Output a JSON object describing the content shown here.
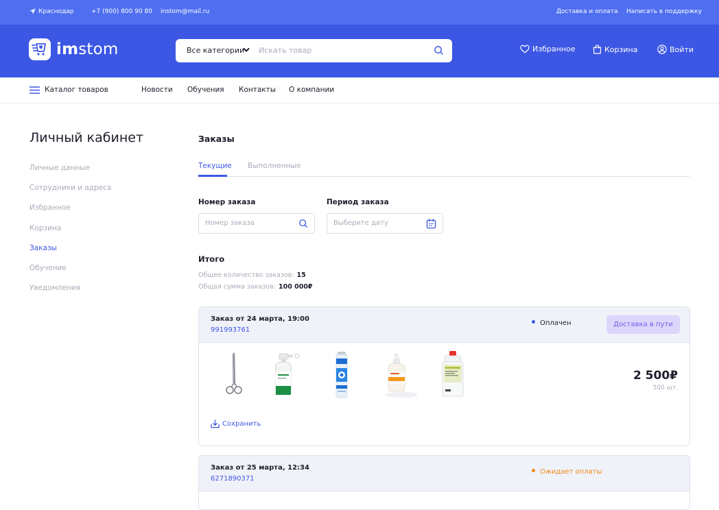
{
  "topbar": {
    "city": "Краснодар",
    "phone": "+7 (900) 800 90 80",
    "email": "instom@mail.ru",
    "delivery": "Доставка и оплата",
    "support": "Написать в поддержку"
  },
  "header": {
    "logo_bold": "im",
    "logo_rest": "stom",
    "search": {
      "category": "Все категории",
      "placeholder": "Искать товар"
    },
    "favorites": "Избранное",
    "cart": "Корзина",
    "login": "Войти"
  },
  "nav": {
    "catalog": "Каталог товаров",
    "items": [
      "Новости",
      "Обучения",
      "Контакты",
      "О компании"
    ]
  },
  "sidebar": {
    "title": "Личный кабинет",
    "items": [
      {
        "label": "Личные данные",
        "active": false
      },
      {
        "label": "Сотрудники и адреса",
        "active": false
      },
      {
        "label": "Избранное",
        "active": false
      },
      {
        "label": "Корзина",
        "active": false
      },
      {
        "label": "Заказы",
        "active": true
      },
      {
        "label": "Обучение",
        "active": false
      },
      {
        "label": "Уведомления",
        "active": false
      }
    ]
  },
  "orders": {
    "title": "Заказы",
    "tabs": [
      {
        "label": "Текущие",
        "active": true
      },
      {
        "label": "Выполненные",
        "active": false
      }
    ],
    "filters": {
      "number_label": "Номер заказа",
      "number_placeholder": "Номер заказа",
      "period_label": "Период заказа",
      "period_placeholder": "Выберите дату"
    },
    "summary": {
      "title": "Итого",
      "count_label": "Общее количество заказов:",
      "count_value": "15",
      "sum_label": "Общая сумма заказов:",
      "sum_value": "100 000₽"
    },
    "list": [
      {
        "title": "Заказ от 24 марта, 19:00",
        "number": "991993761",
        "status": "Оплачен",
        "status_color": "#3c57e4",
        "badge": "Доставка в пути",
        "price": "2 500₽",
        "qty": "500 шт.",
        "save": "Сохранить",
        "products": [
          "scissors-product",
          "spray-bottle-product",
          "aerosol-can-product",
          "dropper-bottle-product",
          "canister-product"
        ]
      },
      {
        "title": "Заказ от 25 марта, 12:34",
        "number": "6271890371",
        "status": "Ожидает оплаты",
        "status_color": "#f08a16"
      }
    ]
  },
  "colors": {
    "topbar": "#4f6ff0",
    "header": "#3c57e4",
    "accent": "#3c57e4",
    "badge_bg": "#dcd6fb",
    "badge_text": "#6d5fe8",
    "pending": "#f08a16"
  }
}
